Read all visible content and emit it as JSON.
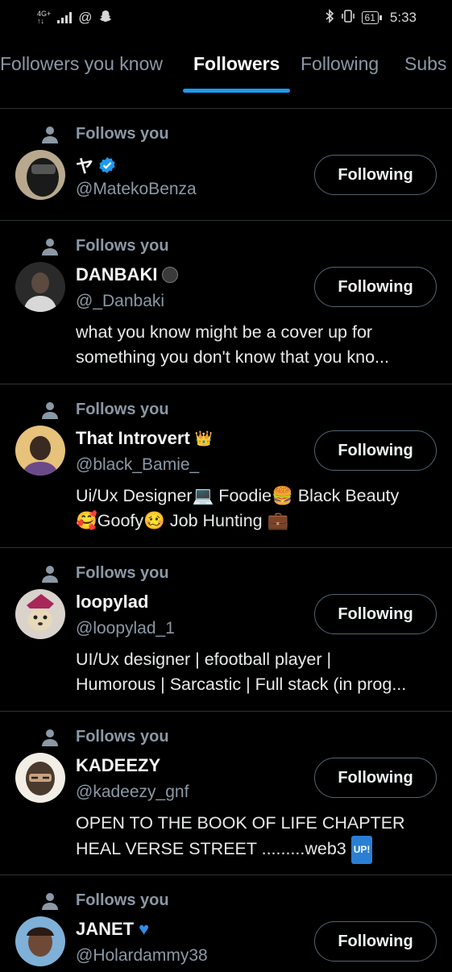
{
  "status_bar": {
    "network": "4G+",
    "battery": "61",
    "time": "5:33"
  },
  "tabs": [
    {
      "label": "Followers you know"
    },
    {
      "label": "Followers"
    },
    {
      "label": "Following"
    },
    {
      "label": "Subs"
    }
  ],
  "active_tab": "Followers",
  "colors": {
    "background": "#000000",
    "accent": "#1d9bf0",
    "secondary_text": "#8b98a5",
    "divider": "#2f3336"
  },
  "follows_you_label": "Follows you",
  "follow_button_label": "Following",
  "users": [
    {
      "name": "ヤ",
      "badge": "verified-icon",
      "handle": "@MatekoBenza",
      "bio_lines": []
    },
    {
      "name": "DANBAKI",
      "badge": "black-circle-emoji",
      "handle": "@_Danbaki",
      "bio_lines": [
        "what you know might be a cover up for",
        "something you don't know that you kno..."
      ]
    },
    {
      "name": "That Introvert",
      "badge": "crown-emoji",
      "handle": "@black_Bamie_",
      "bio_lines": [
        "Ui/Ux Designer💻 Foodie🍔 Black Beauty",
        "🥰Goofy🥴 Job Hunting 💼"
      ]
    },
    {
      "name": "loopylad",
      "badge": "",
      "handle": "@loopylad_1",
      "bio_lines": [
        "UI/Ux designer | efootball player |",
        "Humorous | Sarcastic | Full stack (in prog..."
      ]
    },
    {
      "name": "KADEEZY",
      "badge": "",
      "handle": "@kadeezy_gnf",
      "bio_lines": [
        "OPEN TO THE BOOK OF LIFE CHAPTER",
        "HEAL VERSE STREET .........web3"
      ]
    },
    {
      "name": "JANET",
      "badge": "blue-heart-emoji",
      "handle": "@Holardammy38",
      "bio_lines": []
    }
  ],
  "up_badge": "UP!"
}
